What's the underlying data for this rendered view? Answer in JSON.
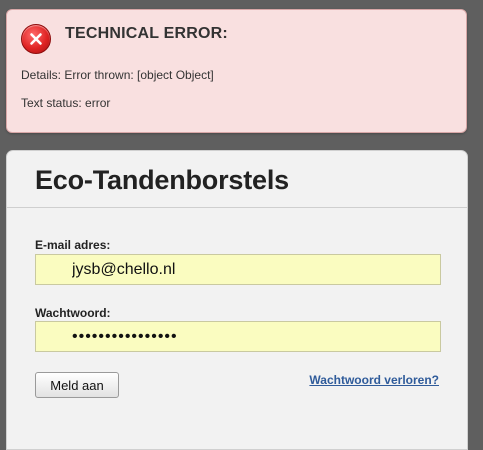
{
  "error": {
    "title": "TECHNICAL ERROR:",
    "icon": "error-circle-x-icon",
    "details": "Details: Error thrown: [object Object]",
    "status": "Text status: error",
    "color": "#e02424"
  },
  "login": {
    "title": "Eco-Tandenborstels",
    "email_label": "E-mail adres:",
    "email_value": "jysb@chello.nl",
    "password_label": "Wachtwoord:",
    "password_value": "••••••••••••••••",
    "submit_label": "Meld aan",
    "forgot_link": "Wachtwoord verloren?",
    "link_color": "#2f5b9a",
    "input_bg": "#fafcc0"
  }
}
